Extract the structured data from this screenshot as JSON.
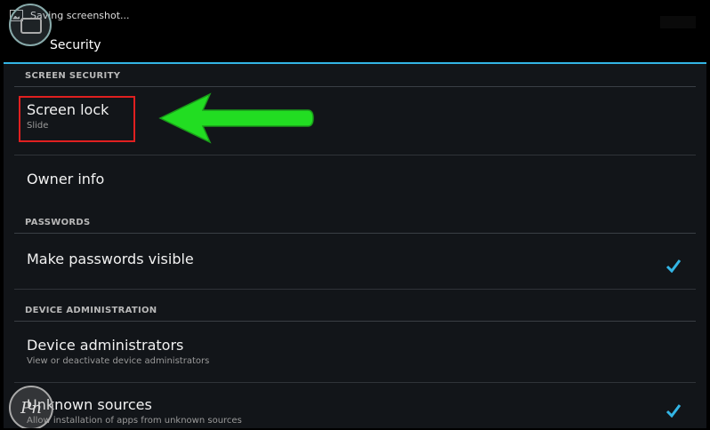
{
  "status_bar": {
    "notification": "Saving screenshot..."
  },
  "action_bar": {
    "title": "Security",
    "accent_color": "#33b5e5"
  },
  "sections": {
    "screen_security": "SCREEN SECURITY",
    "passwords": "PASSWORDS",
    "device_administration": "DEVICE ADMINISTRATION"
  },
  "items": {
    "screen_lock": {
      "title": "Screen lock",
      "summary": "Slide"
    },
    "owner_info": {
      "title": "Owner info"
    },
    "make_passwords_visible": {
      "title": "Make passwords visible",
      "checked": true
    },
    "device_administrators": {
      "title": "Device administrators",
      "summary": "View or deactivate device administrators"
    },
    "unknown_sources": {
      "title": "Unknown sources",
      "summary": "Allow installation of apps from unknown sources",
      "checked": true
    }
  },
  "annotations": {
    "highlight_color": "#e02020",
    "arrow_color": "#22dd22"
  },
  "watermark": {
    "text": "Pn"
  },
  "icons": [
    "screenshot-icon",
    "app-icon",
    "checkmark-icon",
    "arrow-icon"
  ]
}
